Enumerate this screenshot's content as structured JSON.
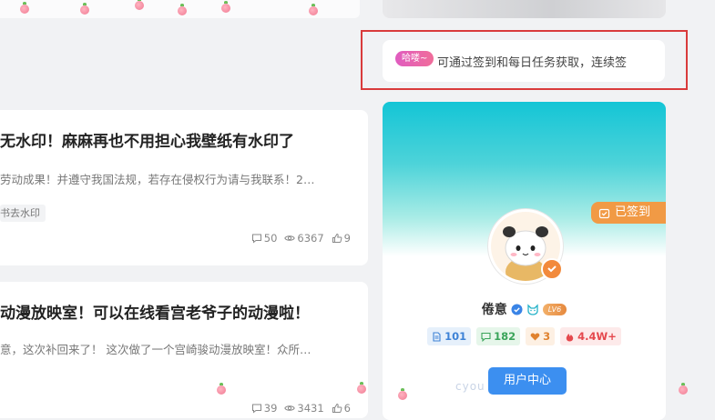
{
  "notice": {
    "badge": "哈喽~",
    "text": "可通过签到和每日任务获取，连续签"
  },
  "posts": [
    {
      "title": "无水印！麻麻再也不用担心我壁纸有水印了",
      "excerpt": "劳动成果！并遵守我国法规，若存在侵权行为请与我联系！2…",
      "tag": "书去水印",
      "comments": "50",
      "views": "6367",
      "likes": "9"
    },
    {
      "title": "动漫放映室！可以在线看宫老爷子的动漫啦！",
      "excerpt": "意，这次补回来了！ 这次做了一个宫崎骏动漫放映室！众所…",
      "comments": "39",
      "views": "3431",
      "likes": "6"
    }
  ],
  "profile": {
    "signed_label": "已签到",
    "username": "倦意",
    "level": "LV6",
    "stats": {
      "posts": "101",
      "comments": "182",
      "likes": "3",
      "hot": "4.4W+"
    },
    "user_center_label": "用户中心"
  },
  "watermark": "cyou",
  "icons": {
    "comment": "comment-icon",
    "view": "eye-icon",
    "like": "thumbs-up-icon",
    "verified": "verified-icon",
    "signed": "calendar-check-icon",
    "hot": "flame-icon"
  },
  "colors": {
    "notice_frame": "#d93b3b",
    "user_center": "#3c8ff0",
    "signed_badge": "#f19a45"
  }
}
